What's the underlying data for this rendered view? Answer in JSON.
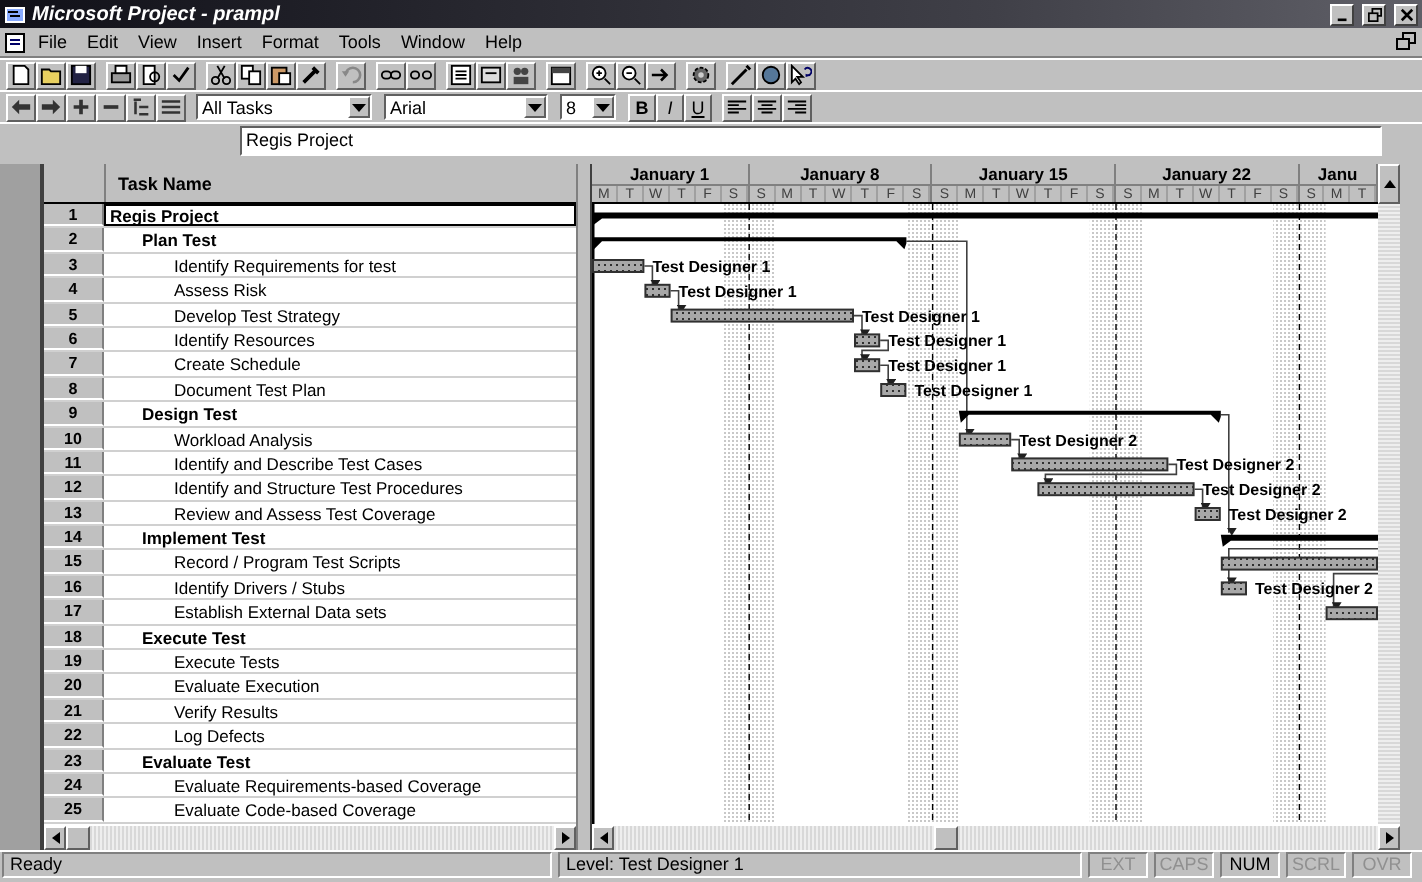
{
  "window": {
    "title": "Microsoft Project - prampl"
  },
  "menu": [
    "File",
    "Edit",
    "View",
    "Insert",
    "Format",
    "Tools",
    "Window",
    "Help"
  ],
  "formatting_toolbar": {
    "filter": "All Tasks",
    "font": "Arial",
    "font_size": "8",
    "style_buttons": [
      "B",
      "I",
      "U"
    ]
  },
  "entry_bar": {
    "value": "Regis Project"
  },
  "table": {
    "columns": [
      "Task Name"
    ],
    "tasks": [
      {
        "id": "1",
        "name": "Regis Project",
        "kind": "summary",
        "selected": true,
        "children": [
          {
            "id": "2",
            "name": "Plan Test",
            "kind": "summary",
            "selected": false,
            "children": [
              {
                "id": "3",
                "name": "Identify Requirements for test",
                "kind": "task",
                "selected": false,
                "resource": "Test Designer 1"
              },
              {
                "id": "4",
                "name": "Assess Risk",
                "kind": "task",
                "selected": false,
                "resource": "Test Designer 1"
              },
              {
                "id": "5",
                "name": "Develop Test Strategy",
                "kind": "task",
                "selected": false,
                "resource": "Test Designer 1"
              },
              {
                "id": "6",
                "name": "Identify Resources",
                "kind": "task",
                "selected": false,
                "resource": "Test Designer 1"
              },
              {
                "id": "7",
                "name": "Create Schedule",
                "kind": "task",
                "selected": false,
                "resource": "Test Designer 1"
              },
              {
                "id": "8",
                "name": "Document Test Plan",
                "kind": "task",
                "selected": false,
                "resource": "Test Designer 1"
              }
            ]
          },
          {
            "id": "9",
            "name": "Design Test",
            "kind": "summary",
            "selected": false,
            "children": [
              {
                "id": "10",
                "name": "Workload Analysis",
                "kind": "task",
                "selected": false,
                "resource": "Test Designer 2"
              },
              {
                "id": "11",
                "name": "Identify and Describe Test Cases",
                "kind": "task",
                "selected": false,
                "resource": "Test Designer 2"
              },
              {
                "id": "12",
                "name": "Identify and Structure Test Procedures",
                "kind": "task",
                "selected": false,
                "resource": "Test Designer 2"
              },
              {
                "id": "13",
                "name": "Review and Assess Test Coverage",
                "kind": "task",
                "selected": false,
                "resource": "Test Designer 2"
              }
            ]
          },
          {
            "id": "14",
            "name": "Implement Test",
            "kind": "summary",
            "selected": false,
            "children": [
              {
                "id": "15",
                "name": "Record / Program Test Scripts",
                "kind": "task",
                "selected": false
              },
              {
                "id": "16",
                "name": "Identify Drivers / Stubs",
                "kind": "task",
                "selected": false,
                "resource": "Test Designer 2"
              },
              {
                "id": "17",
                "name": "Establish External Data sets",
                "kind": "task",
                "selected": false
              }
            ]
          },
          {
            "id": "18",
            "name": "Execute Test",
            "kind": "summary",
            "selected": false,
            "children": [
              {
                "id": "19",
                "name": "Execute Tests",
                "kind": "task",
                "selected": false
              },
              {
                "id": "20",
                "name": "Evaluate Execution",
                "kind": "task",
                "selected": false
              },
              {
                "id": "21",
                "name": "Verify Results",
                "kind": "task",
                "selected": false
              },
              {
                "id": "22",
                "name": "Log Defects",
                "kind": "task",
                "selected": false
              }
            ]
          },
          {
            "id": "23",
            "name": "Evaluate Test",
            "kind": "summary",
            "selected": false,
            "children": [
              {
                "id": "24",
                "name": "Evaluate Requirements-based Coverage",
                "kind": "task",
                "selected": false
              },
              {
                "id": "25",
                "name": "Evaluate Code-based Coverage",
                "kind": "task",
                "selected": false
              }
            ]
          }
        ]
      }
    ]
  },
  "timescale": {
    "weeks": [
      {
        "label": "January 1",
        "days": [
          "M",
          "T",
          "W",
          "T",
          "F",
          "S"
        ]
      },
      {
        "label": "January 8",
        "days": [
          "S",
          "M",
          "T",
          "W",
          "T",
          "F",
          "S"
        ]
      },
      {
        "label": "January 15",
        "days": [
          "S",
          "M",
          "T",
          "W",
          "T",
          "F",
          "S"
        ]
      },
      {
        "label": "January 22",
        "days": [
          "S",
          "M",
          "T",
          "W",
          "T",
          "F",
          "S"
        ]
      },
      {
        "label": "Janu",
        "days": [
          "S",
          "M",
          "T"
        ]
      }
    ]
  },
  "status_bar": {
    "message": "Ready",
    "filter_text": "Level: Test Designer 1",
    "indicators": [
      {
        "label": "EXT",
        "on": false
      },
      {
        "label": "CAPS",
        "on": false
      },
      {
        "label": "NUM",
        "on": true
      },
      {
        "label": "SCRL",
        "on": false
      },
      {
        "label": "OVR",
        "on": false
      }
    ]
  }
}
